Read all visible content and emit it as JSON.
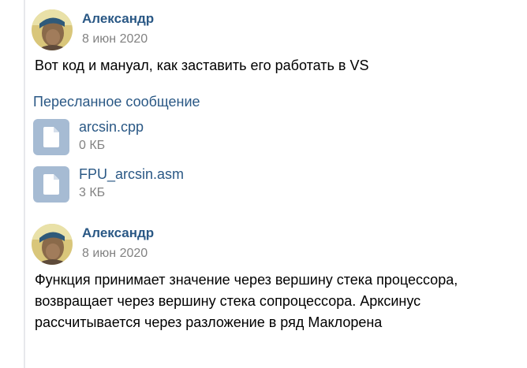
{
  "messages": [
    {
      "author": "Александр",
      "date": "8 июн 2020",
      "text": "Вот код и мануал, как заставить его работать в VS",
      "forwarded_label": "Пересланное сообщение",
      "attachments": [
        {
          "name": "arcsin.cpp",
          "size": "0 КБ",
          "icon": "file-icon"
        },
        {
          "name": "FPU_arcsin.asm",
          "size": "3 КБ",
          "icon": "file-icon"
        }
      ]
    },
    {
      "author": "Александр",
      "date": "8 июн 2020",
      "text": "Функция принимает значение через вершину стека процессора, возвращает через вершину стека сопроцессора. Арксинус рассчитывается через разложение в ряд Маклорена"
    }
  ],
  "colors": {
    "link": "#2a5885",
    "meta": "#828282",
    "file_icon_bg": "#a6bbd3"
  }
}
